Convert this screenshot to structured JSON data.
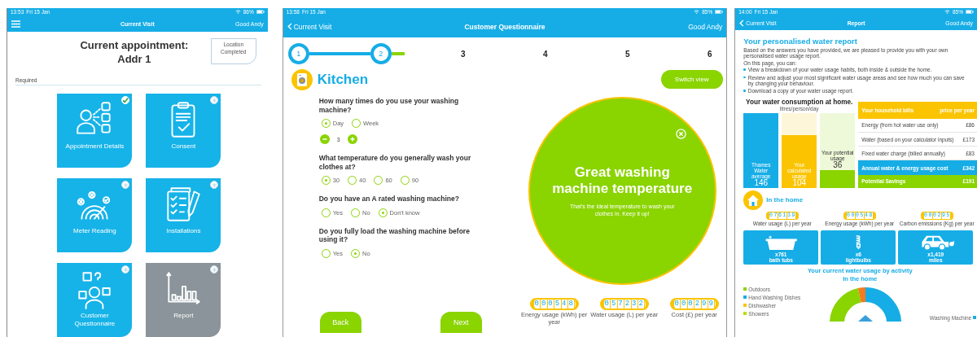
{
  "visit_screen": {
    "status_bar": {
      "time": "13:53",
      "date": "Fri 15 Jan",
      "battery": "86%"
    },
    "nav": {
      "title": "Current Visit",
      "user": "Good Andy"
    },
    "title": "Current appointment:",
    "address": "Addr 1",
    "location_status": "Location Completed",
    "section_label": "Required",
    "tiles": [
      {
        "kind": "appointment",
        "label": "Appointment Details",
        "completed": true,
        "disabled": false
      },
      {
        "kind": "consent",
        "label": "Consent",
        "completed": false,
        "disabled": false
      },
      {
        "kind": "meter",
        "label": "Meter Reading",
        "completed": false,
        "disabled": false
      },
      {
        "kind": "installations",
        "label": "Installations",
        "completed": false,
        "disabled": false
      },
      {
        "kind": "questionnaire",
        "label": "Customer Questionnaire",
        "completed": false,
        "disabled": false
      },
      {
        "kind": "report",
        "label": "Report",
        "completed": false,
        "disabled": true
      }
    ]
  },
  "questionnaire_screen": {
    "status_bar": {
      "time": "13:58",
      "date": "Fri 15 Jan",
      "battery": "85%"
    },
    "nav": {
      "back": "Current Visit",
      "title": "Customer Questionnaire",
      "user": "Good Andy"
    },
    "steps": [
      {
        "label": "1",
        "reached": true
      },
      {
        "label": "2",
        "reached": true
      },
      {
        "label": "3",
        "reached": false
      },
      {
        "label": "4",
        "reached": false
      },
      {
        "label": "5",
        "reached": false
      },
      {
        "label": "6",
        "reached": false
      }
    ],
    "section_title": "Kitchen",
    "switch_button": "Switch view",
    "questions": [
      {
        "text": "How many times do you use your washing machine?",
        "options": [
          {
            "label": "Day",
            "selected": true
          },
          {
            "label": "Week",
            "selected": false
          }
        ],
        "counter_value": "3"
      },
      {
        "text": "What temperature do you generally wash your clothes at?",
        "options": [
          {
            "label": "30",
            "selected": true
          },
          {
            "label": "40",
            "selected": false
          },
          {
            "label": "60",
            "selected": false
          },
          {
            "label": "90",
            "selected": false
          }
        ]
      },
      {
        "text": "Do you have an A rated washing machine?",
        "options": [
          {
            "label": "Yes",
            "selected": false
          },
          {
            "label": "No",
            "selected": false
          },
          {
            "label": "Don't know",
            "selected": true
          }
        ]
      },
      {
        "text": "Do you fully load the washing machine before using it?",
        "options": [
          {
            "label": "Yes",
            "selected": false
          },
          {
            "label": "No",
            "selected": true
          }
        ]
      }
    ],
    "popup": {
      "title": "Great washing machine temperature",
      "message": "That's the ideal temperature to wash your clothes in. Keep it up!"
    },
    "meters": [
      {
        "digits": "000548",
        "label": "Energy usage (kWh) per year"
      },
      {
        "digits": "057232",
        "label": "Water usage (L) per year"
      },
      {
        "digits": "000299",
        "label": "Cost (£) per year"
      }
    ],
    "back_button": "Back",
    "next_button": "Next"
  },
  "report_screen": {
    "status_bar": {
      "time": "14:00",
      "date": "Fri 15 Jan",
      "battery": "85%"
    },
    "nav": {
      "back": "Current Visit",
      "title": "Report",
      "user": "Good Andy"
    },
    "title": "Your personalised water report",
    "paragraph": "Based on the answers you have provided, we are pleased to provide you with your own personalised water usage report.",
    "lead": "On this page, you can:",
    "bullets": [
      "View a breakdown of your water usage habits, both inside & outside the home.",
      "Review and adjust your most significant water usage areas and see how much you can save by changing your behaviour.",
      "Download a copy of your water usage report."
    ],
    "consumption": {
      "title": "Your water consumption at home.",
      "unit": "litres/person/day",
      "bars": [
        {
          "label": "Thames Water average",
          "value": "146",
          "level": 1,
          "color": "#16ade6"
        },
        {
          "label": "Your calculated usage",
          "value": "104",
          "level": 0.71,
          "color": "#fbc400"
        },
        {
          "label": "Your potential usage",
          "value": "36",
          "level": 0.24,
          "color": "#8ad400"
        }
      ]
    },
    "bills": {
      "header_label": "Your household bills",
      "header_price": "price per year",
      "rows": [
        {
          "label": "Energy (from hot water use only)",
          "price": "£86"
        },
        {
          "label": "Water (based on your calculator inputs)",
          "price": "£173"
        },
        {
          "label": "Fixed water charge (billed annually)",
          "price": "£83"
        }
      ],
      "total": {
        "label": "Annual water & energy usage cost",
        "price": "£342"
      },
      "savings": {
        "label": "Potential Savings",
        "price": "£191"
      }
    },
    "home": {
      "title": "In the home",
      "meters": [
        {
          "digits": "076139",
          "label": "Water usage (L) per year"
        },
        {
          "digits": "000548",
          "label": "Energy usage (kWh) per year"
        },
        {
          "digits": "000295",
          "label": "Carbon emissions (Kg) per year"
        }
      ],
      "equivalents": [
        {
          "kind": "bath",
          "value": "x761",
          "label": "bath tubs"
        },
        {
          "kind": "bulb",
          "value": "x6",
          "label": "lightbulbs"
        },
        {
          "kind": "car",
          "value": "x1,419",
          "label": "miles"
        }
      ]
    },
    "activity": {
      "title": "Your current water usage by activity",
      "subtitle": "In the home",
      "legend": [
        {
          "label": "Outdoors",
          "color": "#8ad400"
        },
        {
          "label": "Hand Washing Dishes",
          "color": "#16ade6"
        },
        {
          "label": "Dishwasher",
          "color": "#fbc400"
        },
        {
          "label": "Showers",
          "color": "#b5e000"
        }
      ],
      "right_legend": [
        {
          "label": "Washing Machine",
          "color": "#16ade6"
        }
      ]
    }
  }
}
